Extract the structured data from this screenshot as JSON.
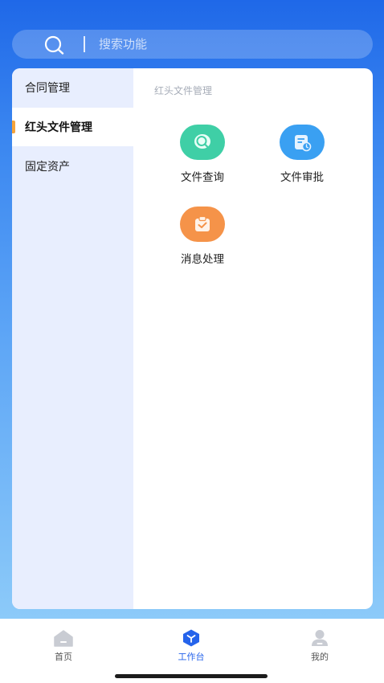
{
  "search": {
    "placeholder": "搜索功能"
  },
  "sidebar": {
    "items": [
      {
        "label": "合同管理"
      },
      {
        "label": "红头文件管理"
      },
      {
        "label": "固定资产"
      }
    ]
  },
  "content": {
    "section_title": "红头文件管理",
    "items": [
      {
        "label": "文件查询",
        "icon": "search-document-icon",
        "color": "#3fcfa6"
      },
      {
        "label": "文件审批",
        "icon": "document-clock-icon",
        "color": "#3aa0f2"
      },
      {
        "label": "消息处理",
        "icon": "clipboard-check-icon",
        "color": "#f59349"
      }
    ]
  },
  "tabbar": {
    "tabs": [
      {
        "label": "首页",
        "icon": "home-icon"
      },
      {
        "label": "工作台",
        "icon": "workbench-icon"
      },
      {
        "label": "我的",
        "icon": "profile-icon"
      }
    ],
    "active_color": "#2563eb"
  }
}
